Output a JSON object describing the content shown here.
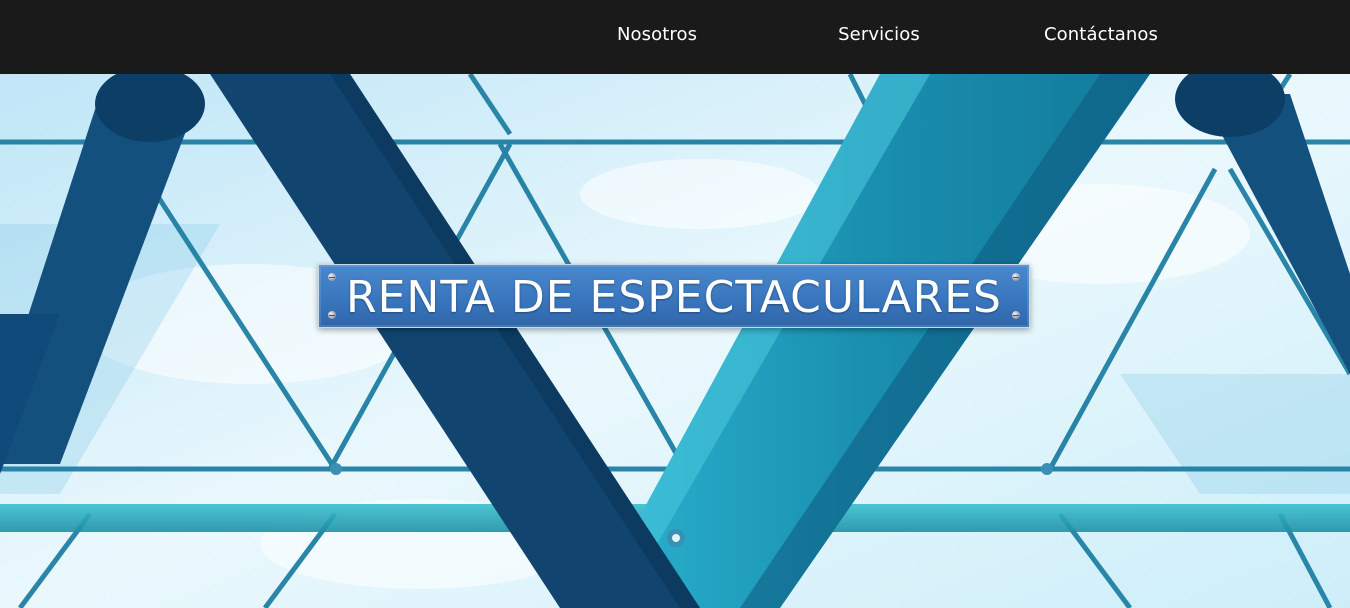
{
  "nav": {
    "items": [
      {
        "label": "Nosotros"
      },
      {
        "label": "Servicios"
      },
      {
        "label": "Contáctanos"
      }
    ]
  },
  "hero": {
    "title": "RENTA DE ESPECTACULARES",
    "background": "steel-glass-roof-image"
  },
  "colors": {
    "topbar": "#1a1a1a",
    "plate": "#3b78c0",
    "steel_dark": "#0f4a7a",
    "steel_teal": "#1e9bb8",
    "sky": "#dff3fb"
  }
}
